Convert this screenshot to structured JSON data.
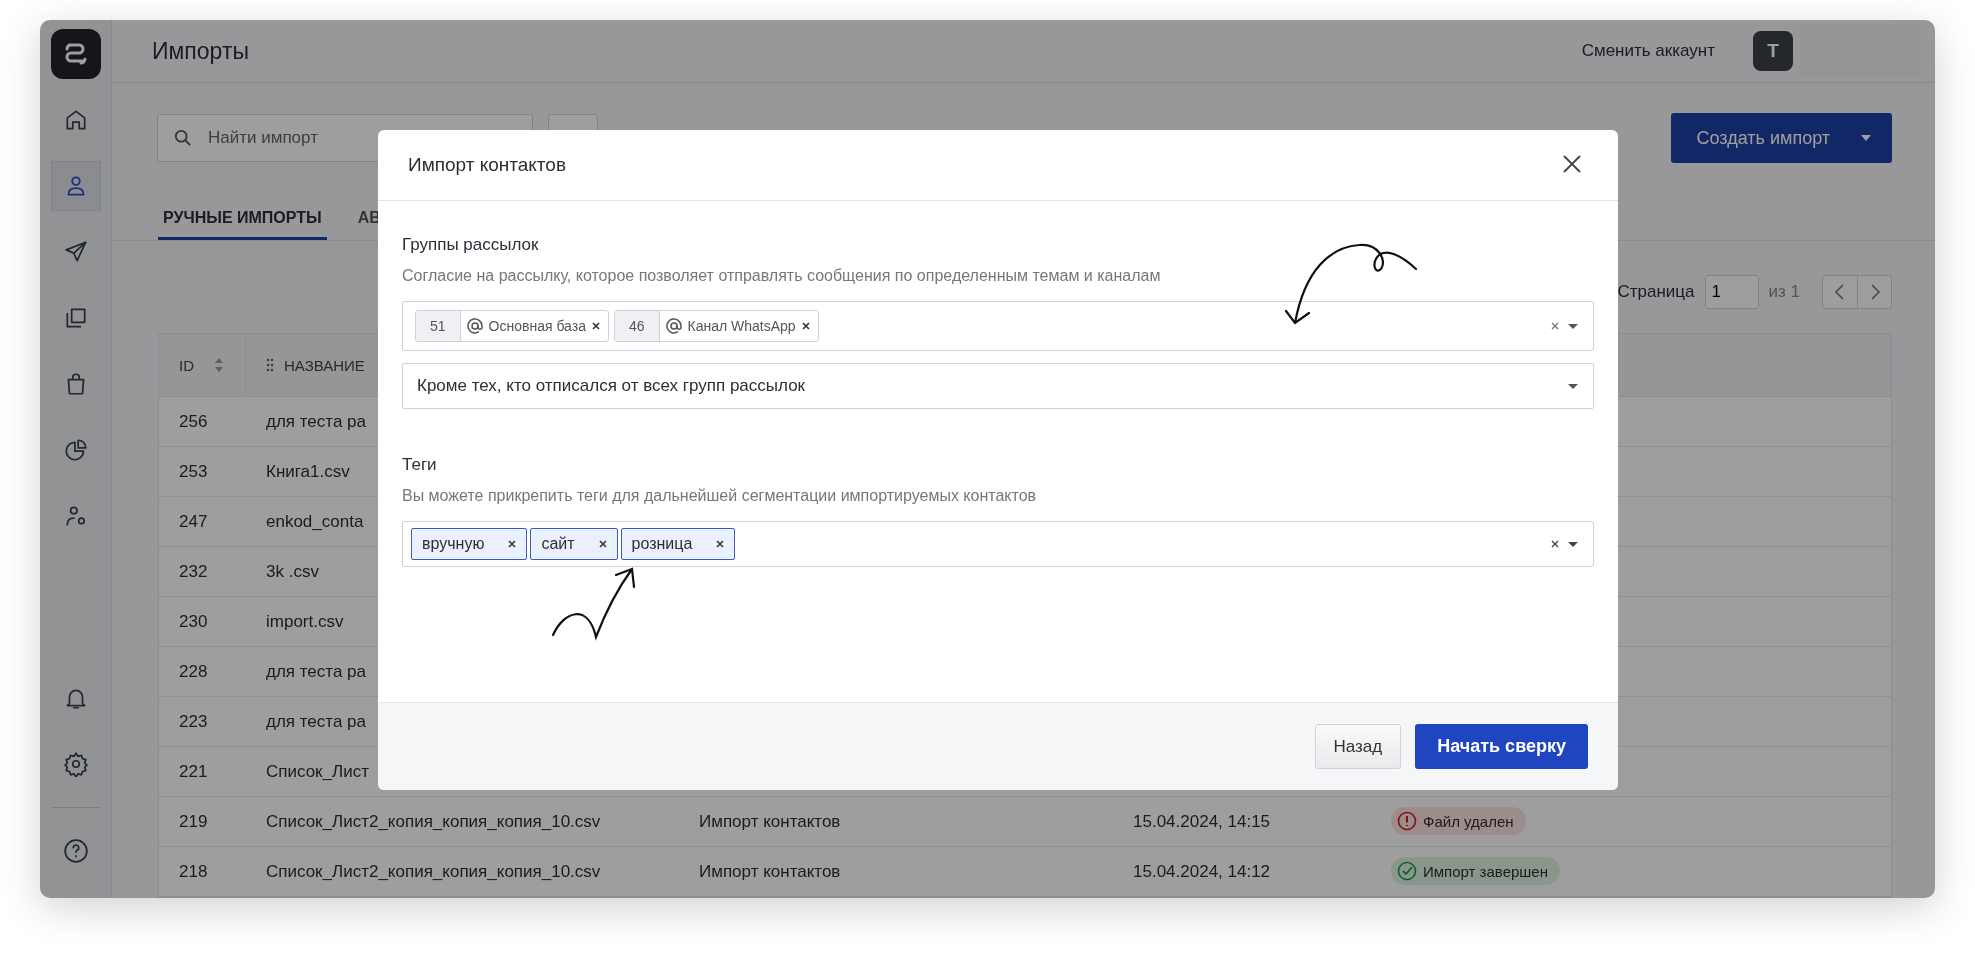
{
  "header": {
    "title": "Импорты",
    "switch_account": "Сменить аккаунт",
    "avatar": "T"
  },
  "sidebar": {
    "items": [
      {
        "selected": false
      },
      {
        "selected": true
      },
      {
        "selected": false
      },
      {
        "selected": false
      },
      {
        "selected": false
      },
      {
        "selected": false
      },
      {
        "selected": false
      }
    ],
    "bottom_items": [
      {
        "selected": false
      },
      {
        "selected": false
      },
      {
        "selected": false
      }
    ]
  },
  "toolbar": {
    "search": {
      "placeholder": "Найти импорт"
    },
    "create_button": "Создать импорт"
  },
  "tabs": [
    {
      "label": "РУЧНЫЕ ИМПОРТЫ",
      "selected": true
    },
    {
      "label": "АВ",
      "selected": false
    }
  ],
  "pagination": {
    "label": "Страница",
    "page": "1",
    "of": "из 1"
  },
  "table": {
    "columns": [
      "ID",
      "НАЗВАНИЕ"
    ],
    "rows": [
      {
        "id": "256",
        "name": "для теста ра"
      },
      {
        "id": "253",
        "name": "Книга1.csv"
      },
      {
        "id": "247",
        "name": "enkod_conta"
      },
      {
        "id": "232",
        "name": "3k .csv"
      },
      {
        "id": "230",
        "name": "import.csv"
      },
      {
        "id": "228",
        "name": "для теста ра"
      },
      {
        "id": "223",
        "name": "для теста ра"
      },
      {
        "id": "221",
        "name": "Список_Лист"
      },
      {
        "id": "219",
        "name": "Список_Лист2_копия_копия_копия_10.csv",
        "type": "Импорт контактов",
        "date": "15.04.2024, 14:15",
        "status": {
          "kind": "error",
          "label": "Файл удален"
        }
      },
      {
        "id": "218",
        "name": "Список_Лист2_копия_копия_копия_10.csv",
        "type": "Импорт контактов",
        "date": "15.04.2024, 14:12",
        "status": {
          "kind": "success",
          "label": "Импорт завершен"
        }
      }
    ]
  },
  "modal": {
    "title": "Импорт контактов",
    "groups": {
      "label": "Группы рассылок",
      "description": "Согласие на рассылку, которое позволяет отправлять сообщения по определенным темам и каналам",
      "chips": [
        {
          "count": "51",
          "label": "Основная база"
        },
        {
          "count": "46",
          "label": "Канал WhatsApp"
        }
      ],
      "filter": "Кроме тех, кто отписался от всех групп рассылок"
    },
    "tags": {
      "label": "Теги",
      "description": "Вы можете прикрепить теги для дальнейшей сегментации импортируемых контактов",
      "chips": [
        {
          "label": "вручную"
        },
        {
          "label": "сайт"
        },
        {
          "label": "розница"
        }
      ]
    },
    "buttons": {
      "back": "Назад",
      "start": "Начать сверку"
    }
  }
}
